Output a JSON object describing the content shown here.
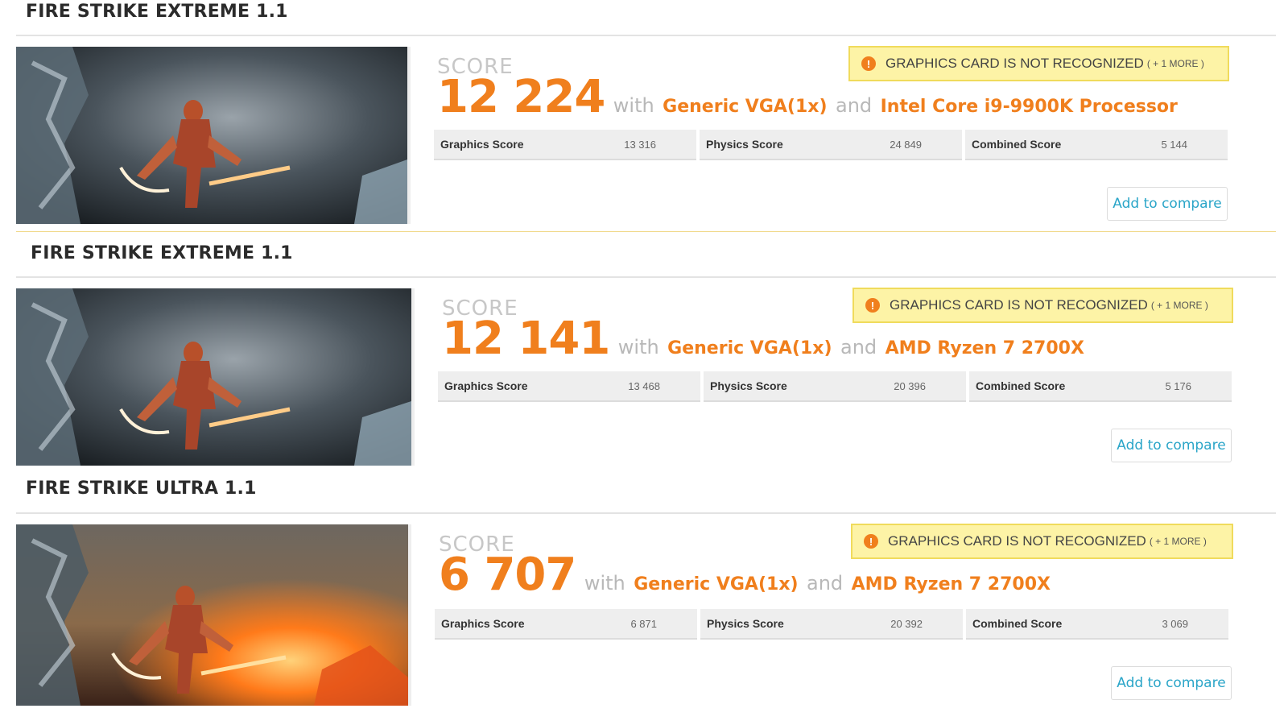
{
  "results": [
    {
      "title": "FIRE STRIKE EXTREME 1.1",
      "score_label": "SCORE",
      "score": "12 224",
      "with": "with",
      "gpu": "Generic VGA(1x)",
      "and": "and",
      "cpu": "Intel Core i9-9900K Processor",
      "warning": "GRAPHICS CARD IS NOT RECOGNIZED",
      "warning_more": "( + 1 MORE )",
      "subscores": [
        {
          "name": "Graphics Score",
          "value": "13 316"
        },
        {
          "name": "Physics Score",
          "value": "24 849"
        },
        {
          "name": "Combined Score",
          "value": "5 144"
        }
      ],
      "compare_label": "Add to compare",
      "thumbnail": "fire-strike-extreme"
    },
    {
      "title": "FIRE STRIKE EXTREME 1.1",
      "score_label": "SCORE",
      "score": "12 141",
      "with": "with",
      "gpu": "Generic VGA(1x)",
      "and": "and",
      "cpu": "AMD Ryzen 7 2700X",
      "warning": "GRAPHICS CARD IS NOT RECOGNIZED",
      "warning_more": "( + 1 MORE )",
      "subscores": [
        {
          "name": "Graphics Score",
          "value": "13 468"
        },
        {
          "name": "Physics Score",
          "value": "20 396"
        },
        {
          "name": "Combined Score",
          "value": "5 176"
        }
      ],
      "compare_label": "Add to compare",
      "thumbnail": "fire-strike-extreme"
    },
    {
      "title": "FIRE STRIKE ULTRA 1.1",
      "score_label": "SCORE",
      "score": "6 707",
      "with": "with",
      "gpu": "Generic VGA(1x)",
      "and": "and",
      "cpu": "AMD Ryzen 7 2700X",
      "warning": "GRAPHICS CARD IS NOT RECOGNIZED",
      "warning_more": "( + 1 MORE )",
      "subscores": [
        {
          "name": "Graphics Score",
          "value": "6 871"
        },
        {
          "name": "Physics Score",
          "value": "20 392"
        },
        {
          "name": "Combined Score",
          "value": "3 069"
        }
      ],
      "compare_label": "Add to compare",
      "thumbnail": "fire-strike-ultra"
    }
  ],
  "colors": {
    "accent": "#f07f1d",
    "warning_bg": "#fdf3a6",
    "link": "#2aa5c8"
  }
}
